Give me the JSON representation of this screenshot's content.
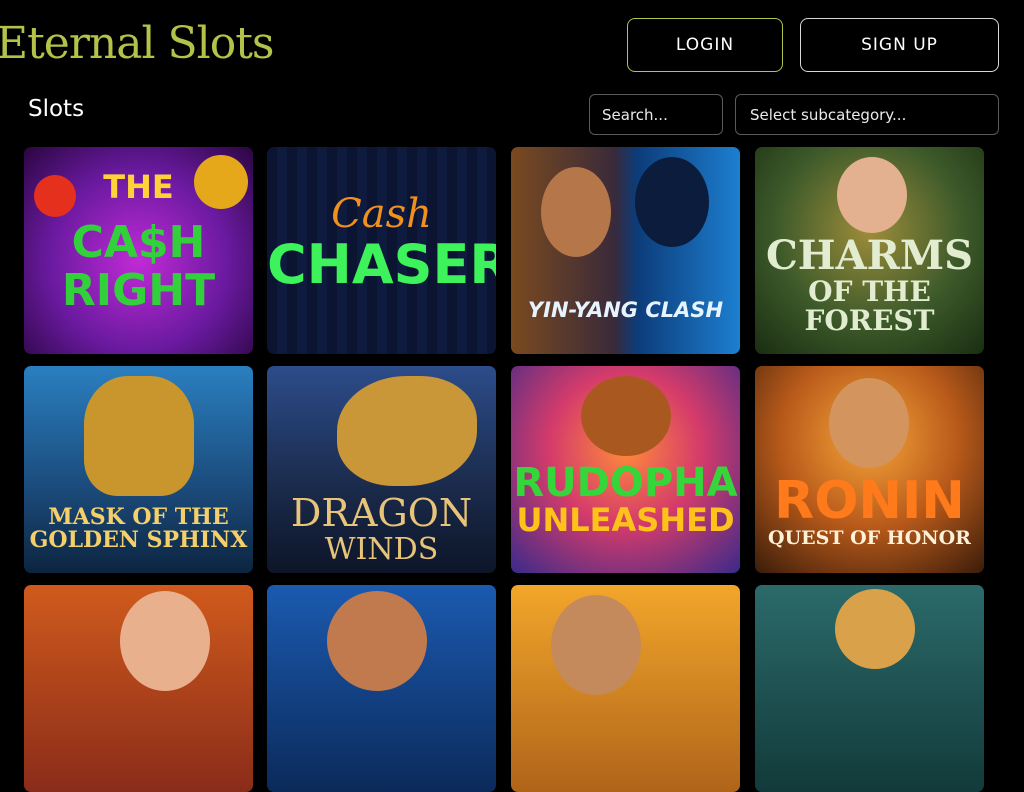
{
  "brand": {
    "logo_text": "Eternal Slots"
  },
  "header": {
    "login_label": "LOGIN",
    "signup_label": "SIGN UP"
  },
  "section": {
    "title": "Slots"
  },
  "search": {
    "placeholder": "Search..."
  },
  "subcategory": {
    "selected_label": "Select subcategory..."
  },
  "colors": {
    "accent": "#b4c24a",
    "background": "#000000"
  },
  "games": [
    {
      "line1": "THE",
      "line2": "CA$H RIGHT"
    },
    {
      "line1": "Cash",
      "line2": "CHASER"
    },
    {
      "line1": "YIN-YANG CLASH",
      "line2": ""
    },
    {
      "line1": "CHARMS",
      "line2": "OF THE FOREST"
    },
    {
      "line1": "MASK OF THE",
      "line2": "GOLDEN SPHINX"
    },
    {
      "line1": "DRAGON",
      "line2": "WINDS"
    },
    {
      "line1": "RUDOPHA",
      "line2": "UNLEASHED"
    },
    {
      "line1": "RONIN",
      "line2": "QUEST OF HONOR"
    },
    {
      "line1": "",
      "line2": ""
    },
    {
      "line1": "",
      "line2": ""
    },
    {
      "line1": "",
      "line2": ""
    },
    {
      "line1": "",
      "line2": ""
    }
  ]
}
